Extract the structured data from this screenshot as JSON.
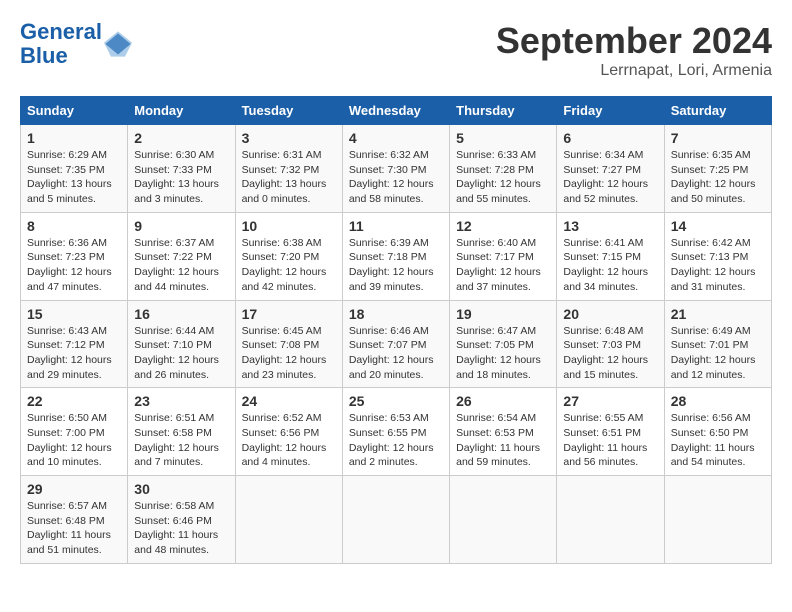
{
  "logo": {
    "line1": "General",
    "line2": "Blue"
  },
  "title": "September 2024",
  "location": "Lerrnapat, Lori, Armenia",
  "days_of_week": [
    "Sunday",
    "Monday",
    "Tuesday",
    "Wednesday",
    "Thursday",
    "Friday",
    "Saturday"
  ],
  "weeks": [
    [
      {
        "day": "1",
        "info": "Sunrise: 6:29 AM\nSunset: 7:35 PM\nDaylight: 13 hours and 5 minutes."
      },
      {
        "day": "2",
        "info": "Sunrise: 6:30 AM\nSunset: 7:33 PM\nDaylight: 13 hours and 3 minutes."
      },
      {
        "day": "3",
        "info": "Sunrise: 6:31 AM\nSunset: 7:32 PM\nDaylight: 13 hours and 0 minutes."
      },
      {
        "day": "4",
        "info": "Sunrise: 6:32 AM\nSunset: 7:30 PM\nDaylight: 12 hours and 58 minutes."
      },
      {
        "day": "5",
        "info": "Sunrise: 6:33 AM\nSunset: 7:28 PM\nDaylight: 12 hours and 55 minutes."
      },
      {
        "day": "6",
        "info": "Sunrise: 6:34 AM\nSunset: 7:27 PM\nDaylight: 12 hours and 52 minutes."
      },
      {
        "day": "7",
        "info": "Sunrise: 6:35 AM\nSunset: 7:25 PM\nDaylight: 12 hours and 50 minutes."
      }
    ],
    [
      {
        "day": "8",
        "info": "Sunrise: 6:36 AM\nSunset: 7:23 PM\nDaylight: 12 hours and 47 minutes."
      },
      {
        "day": "9",
        "info": "Sunrise: 6:37 AM\nSunset: 7:22 PM\nDaylight: 12 hours and 44 minutes."
      },
      {
        "day": "10",
        "info": "Sunrise: 6:38 AM\nSunset: 7:20 PM\nDaylight: 12 hours and 42 minutes."
      },
      {
        "day": "11",
        "info": "Sunrise: 6:39 AM\nSunset: 7:18 PM\nDaylight: 12 hours and 39 minutes."
      },
      {
        "day": "12",
        "info": "Sunrise: 6:40 AM\nSunset: 7:17 PM\nDaylight: 12 hours and 37 minutes."
      },
      {
        "day": "13",
        "info": "Sunrise: 6:41 AM\nSunset: 7:15 PM\nDaylight: 12 hours and 34 minutes."
      },
      {
        "day": "14",
        "info": "Sunrise: 6:42 AM\nSunset: 7:13 PM\nDaylight: 12 hours and 31 minutes."
      }
    ],
    [
      {
        "day": "15",
        "info": "Sunrise: 6:43 AM\nSunset: 7:12 PM\nDaylight: 12 hours and 29 minutes."
      },
      {
        "day": "16",
        "info": "Sunrise: 6:44 AM\nSunset: 7:10 PM\nDaylight: 12 hours and 26 minutes."
      },
      {
        "day": "17",
        "info": "Sunrise: 6:45 AM\nSunset: 7:08 PM\nDaylight: 12 hours and 23 minutes."
      },
      {
        "day": "18",
        "info": "Sunrise: 6:46 AM\nSunset: 7:07 PM\nDaylight: 12 hours and 20 minutes."
      },
      {
        "day": "19",
        "info": "Sunrise: 6:47 AM\nSunset: 7:05 PM\nDaylight: 12 hours and 18 minutes."
      },
      {
        "day": "20",
        "info": "Sunrise: 6:48 AM\nSunset: 7:03 PM\nDaylight: 12 hours and 15 minutes."
      },
      {
        "day": "21",
        "info": "Sunrise: 6:49 AM\nSunset: 7:01 PM\nDaylight: 12 hours and 12 minutes."
      }
    ],
    [
      {
        "day": "22",
        "info": "Sunrise: 6:50 AM\nSunset: 7:00 PM\nDaylight: 12 hours and 10 minutes."
      },
      {
        "day": "23",
        "info": "Sunrise: 6:51 AM\nSunset: 6:58 PM\nDaylight: 12 hours and 7 minutes."
      },
      {
        "day": "24",
        "info": "Sunrise: 6:52 AM\nSunset: 6:56 PM\nDaylight: 12 hours and 4 minutes."
      },
      {
        "day": "25",
        "info": "Sunrise: 6:53 AM\nSunset: 6:55 PM\nDaylight: 12 hours and 2 minutes."
      },
      {
        "day": "26",
        "info": "Sunrise: 6:54 AM\nSunset: 6:53 PM\nDaylight: 11 hours and 59 minutes."
      },
      {
        "day": "27",
        "info": "Sunrise: 6:55 AM\nSunset: 6:51 PM\nDaylight: 11 hours and 56 minutes."
      },
      {
        "day": "28",
        "info": "Sunrise: 6:56 AM\nSunset: 6:50 PM\nDaylight: 11 hours and 54 minutes."
      }
    ],
    [
      {
        "day": "29",
        "info": "Sunrise: 6:57 AM\nSunset: 6:48 PM\nDaylight: 11 hours and 51 minutes."
      },
      {
        "day": "30",
        "info": "Sunrise: 6:58 AM\nSunset: 6:46 PM\nDaylight: 11 hours and 48 minutes."
      },
      {
        "day": "",
        "info": ""
      },
      {
        "day": "",
        "info": ""
      },
      {
        "day": "",
        "info": ""
      },
      {
        "day": "",
        "info": ""
      },
      {
        "day": "",
        "info": ""
      }
    ]
  ]
}
